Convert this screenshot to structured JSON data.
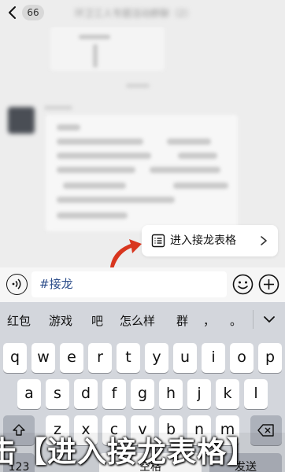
{
  "header": {
    "badge_count": "66",
    "title_blurred": "环卫工人专题活动群聊（2）"
  },
  "chat": {
    "blurred_lines": [
      "下载",
      "示意图"
    ]
  },
  "popup": {
    "label": "进入接龙表格"
  },
  "input": {
    "value": "#接龙"
  },
  "keyboard": {
    "suggestions": [
      "红包",
      "游戏",
      "吧",
      "怎么样",
      "群",
      "，",
      "。"
    ],
    "row1": [
      "q",
      "w",
      "e",
      "r",
      "t",
      "y",
      "u",
      "i",
      "o",
      "p"
    ],
    "row2": [
      "a",
      "s",
      "d",
      "f",
      "g",
      "h",
      "j",
      "k",
      "l"
    ],
    "row3": [
      "z",
      "x",
      "c",
      "v",
      "b",
      "n",
      "m"
    ],
    "bottom_partial": [
      "123",
      "空格",
      "发送"
    ]
  },
  "caption": {
    "text": "击【进入接龙表格】"
  },
  "colors": {
    "accent_red": "#d8361f",
    "input_text": "#2c4d8a",
    "keyboard_bg": "#d3d6dc"
  }
}
